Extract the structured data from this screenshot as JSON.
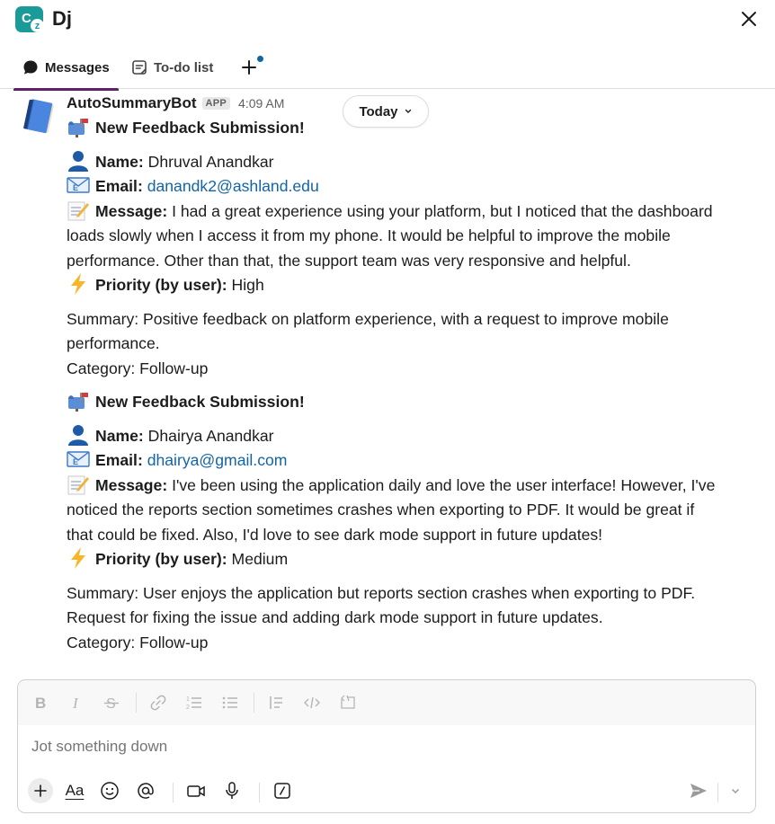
{
  "header": {
    "logo_letter": "C",
    "logo_badge": "z",
    "title": "Dj"
  },
  "tabs": [
    {
      "label": "Messages",
      "active": true,
      "icon": "chat-bubble-icon"
    },
    {
      "label": "To-do list",
      "active": false,
      "icon": "todo-note-icon"
    }
  ],
  "message": {
    "sender": "AutoSummaryBot",
    "badge": "APP",
    "time": "4:09 AM",
    "date_pill": "Today",
    "submissions": [
      {
        "heading": "New Feedback Submission!",
        "name_label": "Name:",
        "name": "Dhruval Anandkar",
        "email_label": "Email:",
        "email": "danandk2@ashland.edu",
        "message_label": "Message:",
        "message_lines": [
          "I had a great experience using your platform, but I noticed that the dashboard",
          "loads slowly when I access it from my phone. It would be helpful to improve the mobile",
          "performance. Other than that, the support team was very responsive and helpful."
        ],
        "priority_label": "Priority (by user):",
        "priority": "High",
        "summary_lines": [
          "Summary: Positive feedback on platform experience, with a request to improve mobile",
          "performance."
        ],
        "category": "Category: Follow-up"
      },
      {
        "heading": "New Feedback Submission!",
        "name_label": "Name:",
        "name": "Dhairya Anandkar",
        "email_label": "Email:",
        "email": "dhairya@gmail.com",
        "message_label": "Message:",
        "message_lines": [
          "I've been using the application daily and love the user interface! However, I've",
          "noticed the reports section sometimes crashes when exporting to PDF. It would be great if",
          "that could be fixed. Also, I'd love to see dark mode support in future updates!"
        ],
        "priority_label": "Priority (by user):",
        "priority": "Medium",
        "summary_lines": [
          "Summary: User enjoys the application but reports section crashes when exporting to PDF.",
          "Request for fixing the issue and adding dark mode support in future updates."
        ],
        "category": "Category: Follow-up"
      }
    ]
  },
  "composer": {
    "placeholder": "Jot something down",
    "format_label": "Aa"
  },
  "colors": {
    "link": "#1264a3",
    "tab_active": "#611f69",
    "logo": "#1b9a9a"
  }
}
